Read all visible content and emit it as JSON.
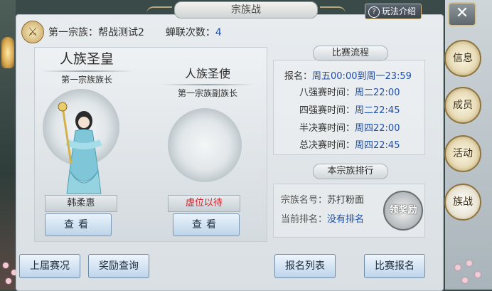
{
  "window": {
    "title": "宗族战",
    "help_label": "玩法介绍",
    "close_symbol": "✕"
  },
  "clan": {
    "first_clan_label": "第一宗族：帮战测试2",
    "win_count_label": "蝉联次数：",
    "win_count": "4"
  },
  "leaders": [
    {
      "title": "人族圣皇",
      "role": "第一宗族族长",
      "name": "韩柔惠",
      "name_color": "#333333",
      "view_label": "查看"
    },
    {
      "title": "人族圣使",
      "role": "第一宗族副族长",
      "name": "虚位以待",
      "name_color": "#d1202a",
      "view_label": "查看"
    }
  ],
  "schedule": {
    "title": "比赛流程",
    "rows": [
      {
        "label": "报名：",
        "value": "周五00:00到周一23:59"
      },
      {
        "label": "八强赛时间：",
        "value": "周二22:00"
      },
      {
        "label": "四强赛时间：",
        "value": "周二22:45"
      },
      {
        "label": "半决赛时间：",
        "value": "周四22:00"
      },
      {
        "label": "总决赛时间：",
        "value": "周四22:45"
      }
    ]
  },
  "ranking": {
    "title": "本宗族排行",
    "clan_name_label": "宗族名号：",
    "clan_name": "苏打粉面",
    "rank_label": "当前排名：",
    "rank_value": "没有排名",
    "claim_label": "领奖励"
  },
  "bottom_buttons": {
    "last_season": "上届赛况",
    "reward_query": "奖励查询",
    "signup_list": "报名列表",
    "signup": "比赛报名"
  },
  "side_tabs": [
    {
      "label": "信息"
    },
    {
      "label": "成员"
    },
    {
      "label": "活动"
    },
    {
      "label": "族战",
      "active": true
    }
  ],
  "colors": {
    "accent_blue": "#1f4fa8",
    "vacant_red": "#d1202a",
    "gold_trim": "#c9b37c"
  }
}
